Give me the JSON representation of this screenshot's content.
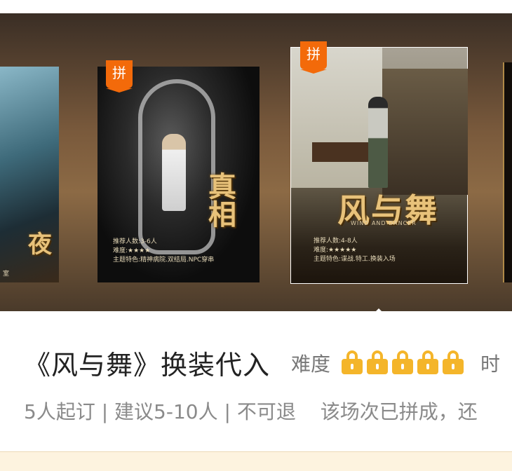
{
  "posters": [
    {
      "title": "夜",
      "info": "室",
      "badge": ""
    },
    {
      "title": "真相",
      "info_lines": [
        "推荐人数:3-6人",
        "难度:★★★★",
        "主题特色:精神病院.双结局.NPC穿串"
      ],
      "badge": "拼"
    },
    {
      "title": "风与舞",
      "subtitle": "WIND AND DANCER",
      "info_lines": [
        "推荐人数:4-8人",
        "难度:★★★★★",
        "主题特色:谍战.特工.换装入场"
      ],
      "badge": "拼"
    }
  ],
  "detail": {
    "title": "《风与舞》换装代入",
    "difficulty_label": "难度",
    "difficulty_level": 5,
    "difficulty_max": 5,
    "trailing_text": "时",
    "meta": "5人起订 | 建议5-10人 | 不可退",
    "status": "该场次已拼成，还"
  },
  "colors": {
    "badge": "#f36a0a",
    "lock": "#f4b52a",
    "title_text": "#222222",
    "muted_text": "#8a8a8a"
  },
  "icons": [
    "lock-icon"
  ]
}
